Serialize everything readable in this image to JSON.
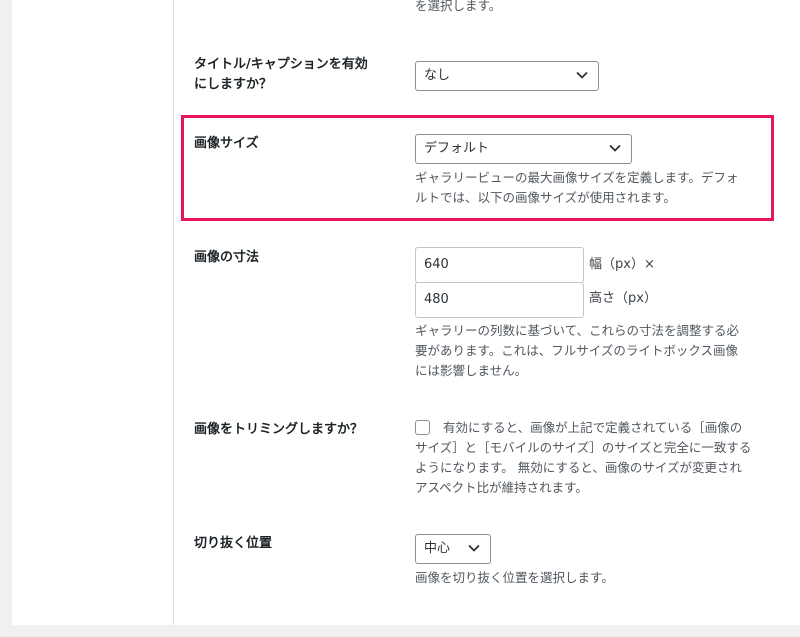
{
  "top_desc": "を選択します。",
  "caption_setting": {
    "label_line1": "タイトル/キャプションを有効",
    "label_line2": "にしますか？",
    "value": "なし"
  },
  "image_size": {
    "label": "画像サイズ",
    "value": "デフォルト",
    "desc_line1": "ギャラリービューの最大画像サイズを定義します。デフォ",
    "desc_line2": "ルトでは、以下の画像サイズが使用されます。"
  },
  "dimensions": {
    "label": "画像の寸法",
    "width_value": "640",
    "width_unit": "幅（px）×",
    "height_value": "480",
    "height_unit": "高さ（px）",
    "desc_line1": "ギャラリーの列数に基づいて、これらの寸法を調整する必",
    "desc_line2": "要があります。これは、フルサイズのライトボックス画像",
    "desc_line3": "には影響しません。"
  },
  "crop": {
    "label": "画像をトリミングしますか？",
    "checked": false,
    "desc_line1": "有効にすると、画像が上記で定義されている［画像の",
    "desc_line2": "サイズ］と［モバイルのサイズ］のサイズと完全に一致する",
    "desc_line3": "ようになります。 無効にすると、画像のサイズが変更され",
    "desc_line4": "アスペクト比が維持されます。"
  },
  "crop_position": {
    "label": "切り抜く位置",
    "value": "中心",
    "desc": "画像を切り抜く位置を選択します。"
  },
  "colors": {
    "highlight": "#e8145f",
    "label": "#1d2327",
    "desc": "#50575e"
  },
  "icons": {
    "dropdown": "chevron-down-icon"
  }
}
